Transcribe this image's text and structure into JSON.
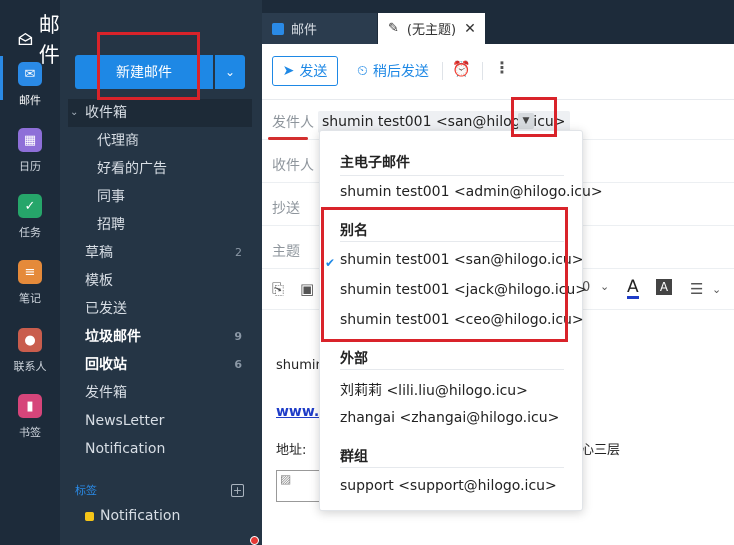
{
  "app": {
    "title": "邮件"
  },
  "rail": {
    "items": [
      {
        "label": "邮件",
        "icon": "mail-icon",
        "color": "#2a8ae6"
      },
      {
        "label": "日历",
        "icon": "calendar-icon",
        "color": "#8e6fd8"
      },
      {
        "label": "任务",
        "icon": "task-icon",
        "color": "#26a66a"
      },
      {
        "label": "笔记",
        "icon": "note-icon",
        "color": "#e58a3a"
      },
      {
        "label": "联系人",
        "icon": "contact-icon",
        "color": "#c95d4d"
      },
      {
        "label": "书签",
        "icon": "bookmark-icon",
        "color": "#d6457a"
      }
    ]
  },
  "sidebar": {
    "new_mail": "新建邮件",
    "inbox": "收件箱",
    "inbox_subfolders": [
      "代理商",
      "好看的广告",
      "同事",
      "招聘"
    ],
    "folders": [
      {
        "label": "草稿",
        "count": "2",
        "bold": false
      },
      {
        "label": "模板",
        "count": "",
        "bold": false
      },
      {
        "label": "已发送",
        "count": "",
        "bold": false
      },
      {
        "label": "垃圾邮件",
        "count": "9",
        "bold": true
      },
      {
        "label": "回收站",
        "count": "6",
        "bold": true
      },
      {
        "label": "发件箱",
        "count": "",
        "bold": false
      },
      {
        "label": "NewsLetter",
        "count": "",
        "bold": false
      },
      {
        "label": "Notification",
        "count": "",
        "bold": false
      }
    ],
    "tags_heading": "标签",
    "tag": "Notification"
  },
  "tabs": [
    {
      "label": "邮件"
    },
    {
      "label": "(无主题)"
    }
  ],
  "toolbar": {
    "send": "发送",
    "send_later": "稍后发送"
  },
  "compose": {
    "from_label": "发件人",
    "from_value": "shumin test001 <san@hilogo.icu>",
    "to_label": "收件人",
    "cc_label": "抄送",
    "subject_label": "主题"
  },
  "editor": {
    "font_size_fragment": "0"
  },
  "body": {
    "line1": "shumin",
    "link": "www.",
    "address": "地址:",
    "address_tail": "心三层"
  },
  "dropdown": {
    "primary_heading": "主电子邮件",
    "primary": [
      "shumin test001 <admin@hilogo.icu>"
    ],
    "alias_heading": "别名",
    "aliases": [
      "shumin test001 <san@hilogo.icu>",
      "shumin test001 <jack@hilogo.icu>",
      "shumin test001 <ceo@hilogo.icu>"
    ],
    "selected_index": 0,
    "external_heading": "外部",
    "external": [
      "刘莉莉 <lili.liu@hilogo.icu>",
      "zhangai <zhangai@hilogo.icu>"
    ],
    "group_heading": "群组",
    "groups": [
      "support <support@hilogo.icu>"
    ]
  },
  "colors": {
    "accent": "#1e88e5",
    "annotation": "#d9232a"
  }
}
